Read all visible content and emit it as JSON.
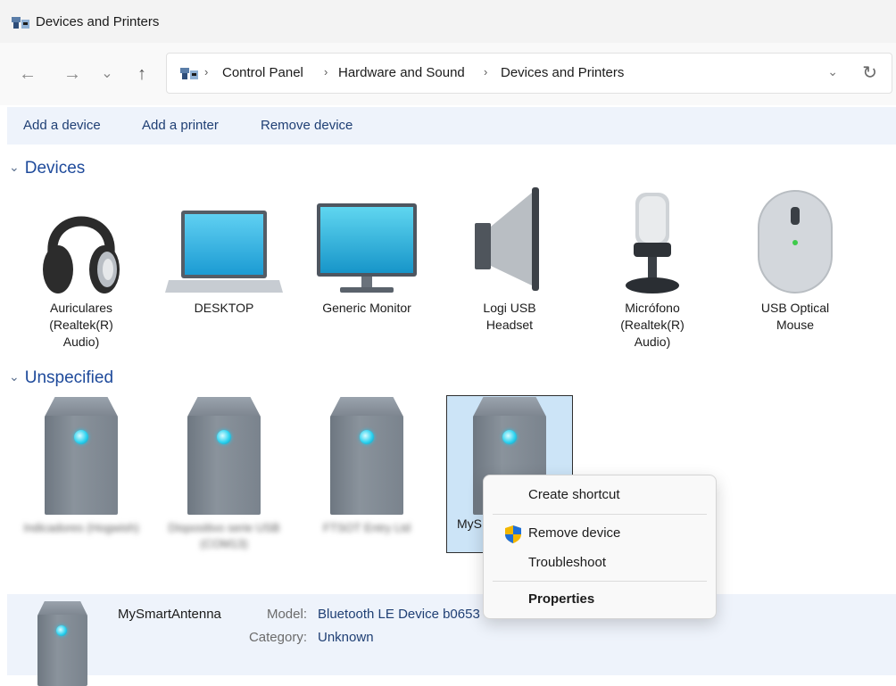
{
  "window": {
    "title": "Devices and Printers"
  },
  "nav": {
    "back": "←",
    "forward": "→",
    "recent": "⌄",
    "up": "↑",
    "breadcrumbs": [
      "Control Panel",
      "Hardware and Sound",
      "Devices and Printers"
    ],
    "separator": "›",
    "dropdown": "⌄",
    "refresh": "↻"
  },
  "commands": {
    "add_device": "Add a device",
    "add_printer": "Add a printer",
    "remove_device": "Remove device"
  },
  "groups": {
    "devices": {
      "label": "Devices",
      "items": [
        {
          "label": "Auriculares (Realtek(R) Audio)",
          "icon": "headphones-icon"
        },
        {
          "label": "DESKTOP",
          "icon": "laptop-icon"
        },
        {
          "label": "Generic Monitor",
          "icon": "monitor-icon"
        },
        {
          "label": "Logi USB Headset",
          "icon": "speaker-icon"
        },
        {
          "label": "Micrófono (Realtek(R) Audio)",
          "icon": "microphone-icon"
        },
        {
          "label": "USB Optical Mouse",
          "icon": "mouse-icon"
        }
      ]
    },
    "unspecified": {
      "label": "Unspecified",
      "items": [
        {
          "label": "Indicadores (Hogwish)",
          "icon": "device-tower-icon"
        },
        {
          "label": "Dispositivo serie USB (COM13)",
          "icon": "device-tower-icon"
        },
        {
          "label": "FTSOT Entry Ltd",
          "icon": "device-tower-icon"
        },
        {
          "label": "MyS",
          "icon": "device-tower-icon"
        }
      ]
    },
    "chevron": "⌄"
  },
  "context_menu": {
    "create_shortcut": "Create shortcut",
    "remove_device": "Remove device",
    "troubleshoot": "Troubleshoot",
    "properties": "Properties"
  },
  "details": {
    "name": "MySmartAntenna",
    "model_label": "Model:",
    "model_value": "Bluetooth LE Device b0653",
    "category_label": "Category:",
    "category_value": "Unknown"
  },
  "colors": {
    "accent": "#1e4a9b",
    "command_bar": "#eef3fb",
    "selection": "#cce4f7",
    "led": "#2ed3f0"
  }
}
